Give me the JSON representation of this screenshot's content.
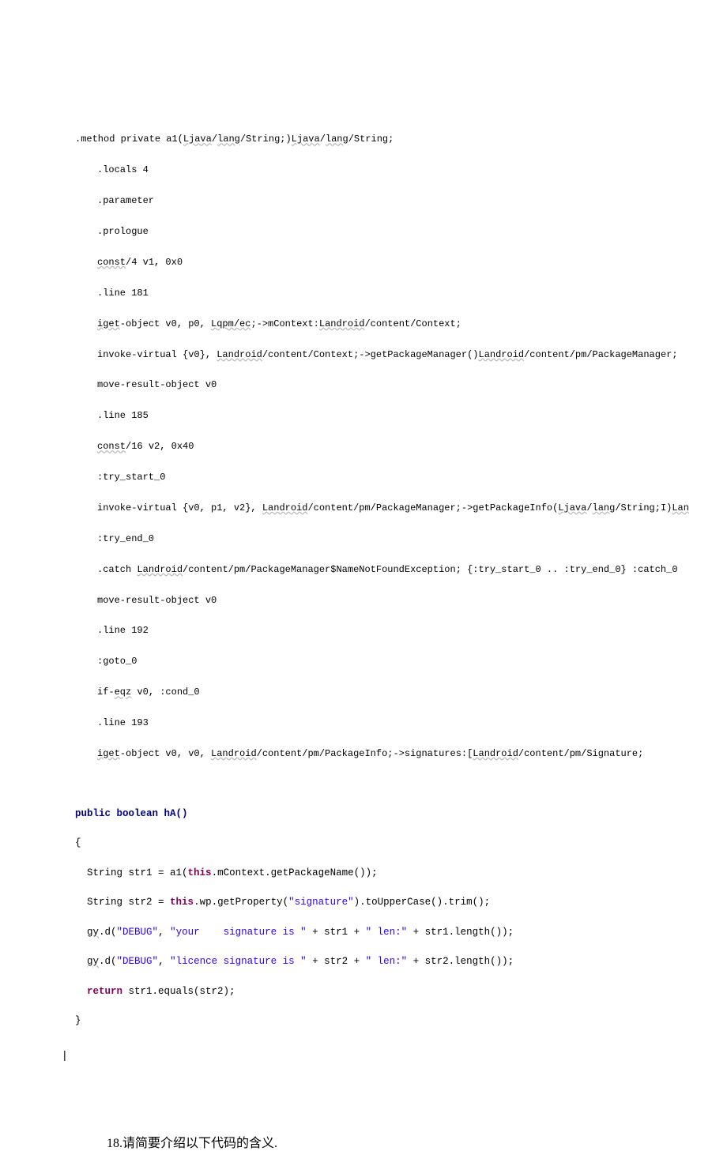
{
  "smali": {
    "l0": ".method private a1(",
    "l0b": "/String;)",
    "l0c": "/String;",
    "l1": ".locals 4",
    "l2": ".parameter",
    "l3": ".prologue",
    "l4a": "const",
    "l4b": "/4 v1, 0x0",
    "l5": ".line 181",
    "l6a": "iget",
    "l6b": "-object v0, p0, ",
    "l6c": ";->mContext:",
    "l6d": "/content/Context;",
    "l7a": "invoke-virtual {v0}, ",
    "l7b": "/content/Context;->getPackageManager()",
    "l7c": "/content/pm/PackageManager;",
    "l8": "move-result-object v0",
    "l9": ".line 185",
    "l10a": "const",
    "l10b": "/16 v2, 0x40",
    "l11": ":try_start_0",
    "l12a": "invoke-virtual {v0, p1, v2}, ",
    "l12b": "/content/pm/PackageManager;->getPackageInfo(",
    "l12c": "/String;I)",
    "l13": ":try_end_0",
    "l14a": ".catch ",
    "l14b": "/content/pm/PackageManager$NameNotFoundException; {:try_start_0 .. :try_end_0} :catch_0",
    "l15": "move-result-object v0",
    "l16": ".line 192",
    "l17": ":goto_0",
    "l18a": "if-",
    "l18b": " v0, :cond_0",
    "l19": ".line 193",
    "l20a": "iget",
    "l20b": "-object v0, v0, ",
    "l20c": "/content/pm",
    "l20d": "/PackageInfo;->signatures:[",
    "l20e": "/content/pm/Signature;",
    "u_ljava_lang": "Ljava/lang",
    "u_landroid": "Landroid",
    "u_lqpm_ec": "Lqpm/ec",
    "u_ljava": "Ljava",
    "u_lang": "lang",
    "u_lan": "Lan",
    "u_eqz": "eqz"
  },
  "java": {
    "sig": "public boolean hA()",
    "open": "{",
    "l1a": "String str1 = a1(",
    "l1b": ".mContext.getPackageName());",
    "l2a": "String str2 = ",
    "l2b": ".wp.getProperty(",
    "l2c": ").toUpperCase().trim();",
    "l3a": ".d(",
    "l3b": ", ",
    "l3c": " + str1 + ",
    "l3d": " + str1.length());",
    "l4a": ".d(",
    "l4b": ", ",
    "l4c": " + str2 + ",
    "l4d": " + str2.length());",
    "l5a": " str1.equals(str2);",
    "close": "}",
    "kw_this": "this",
    "kw_return": "return",
    "id_gy": "gy",
    "str_sig": "\"signature\"",
    "str_debug": "\"DEBUG\"",
    "str_your": "\"your    signature is \"",
    "str_lic": "\"licence signature is \"",
    "str_len": "\" len:\""
  },
  "question": "18.请简要介绍以下代码的含义.",
  "cursor": "|"
}
